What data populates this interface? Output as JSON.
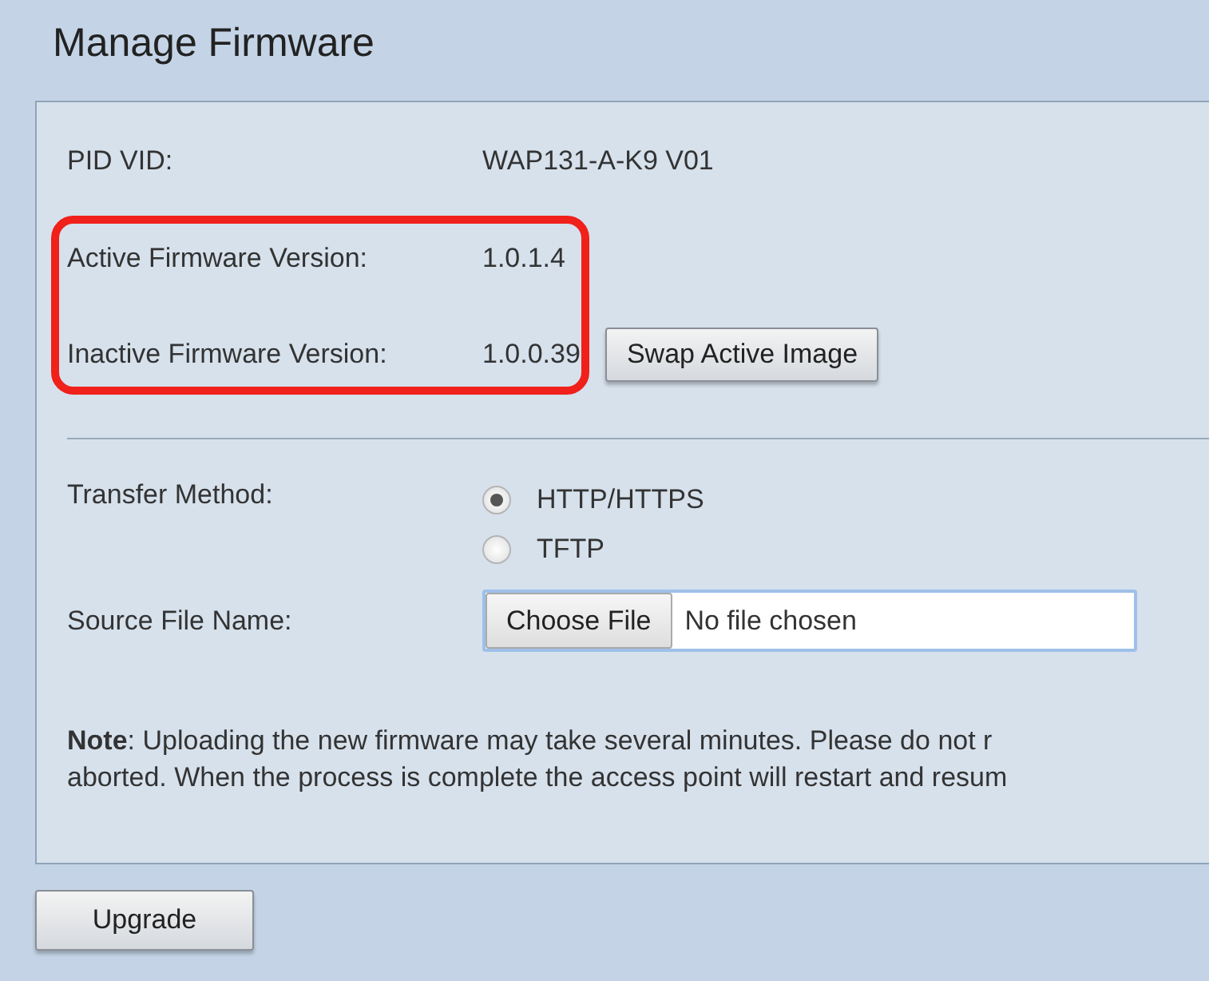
{
  "title": "Manage Firmware",
  "info_rows": [
    {
      "label": "PID VID:",
      "value": "WAP131-A-K9 V01",
      "highlighted": false
    },
    {
      "label": "Active Firmware Version:",
      "value": "1.0.1.4",
      "highlighted": true
    },
    {
      "label": "Inactive Firmware Version:",
      "value": "1.0.0.39",
      "highlighted": true,
      "button": "Swap Active Image"
    }
  ],
  "highlight": {
    "color": "#f0201a"
  },
  "transfer_method": {
    "label": "Transfer Method:",
    "options": [
      {
        "label": "HTTP/HTTPS",
        "selected": true
      },
      {
        "label": "TFTP",
        "selected": false
      }
    ]
  },
  "source_file": {
    "label": "Source File Name:",
    "button": "Choose File",
    "value": "No file chosen"
  },
  "note_lines": [
    "**Note**: Uploading the new firmware may take several minutes. Please do not r",
    "aborted. When the process is complete the access point will restart and resum"
  ],
  "upgrade_button": "Upgrade"
}
